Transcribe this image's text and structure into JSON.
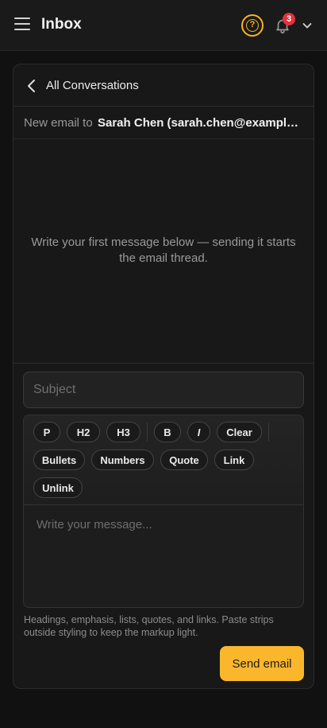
{
  "header": {
    "title": "Inbox",
    "menu_icon": "hamburger-menu-icon",
    "help_icon": "help-circle-icon",
    "notification_icon": "bell-icon",
    "notification_count": "3",
    "account_icon": "chevron-down-icon"
  },
  "composer": {
    "back_label": "All Conversations",
    "to_label": "New email to",
    "to_value": "Sarah Chen (sarah.chen@example.com)",
    "empty_message": "Write your first message below — sending it starts the email thread.",
    "subject_placeholder": "Subject",
    "body_placeholder": "Write your message...",
    "toolbar": {
      "paragraph": "P",
      "h2": "H2",
      "h3": "H3",
      "bold": "B",
      "italic": "I",
      "clear": "Clear",
      "bullets": "Bullets",
      "numbers": "Numbers",
      "quote": "Quote",
      "link": "Link",
      "unlink": "Unlink"
    },
    "hint": "Headings, emphasis, lists, quotes, and links. Paste strips outside styling to keep the markup light.",
    "send_label": "Send email"
  },
  "colors": {
    "accent": "#fbb72c",
    "badge": "#e5303b",
    "background": "#111111",
    "card": "#181818"
  }
}
